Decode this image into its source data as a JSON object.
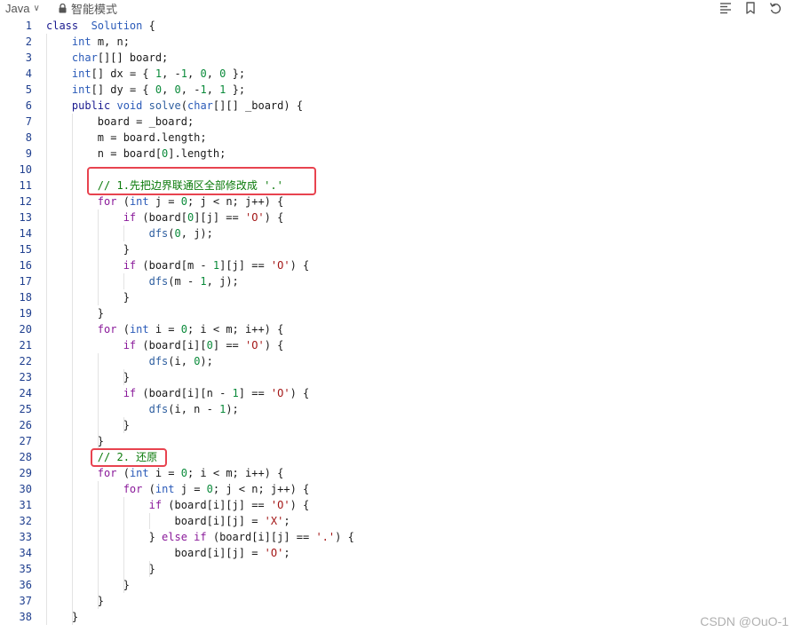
{
  "toolbar": {
    "language": "Java",
    "language_chevron": "∨",
    "mode_label": "智能模式"
  },
  "icons": [
    "chevron-down-icon",
    "lock-icon",
    "list-icon",
    "bookmark-icon",
    "undo-icon"
  ],
  "watermark": "CSDN @OuO-1",
  "colors": {
    "highlight": "#e8434f",
    "line_number": "#1f3f8f"
  },
  "lines": [
    {
      "n": "1",
      "toks": [
        [
          "kw",
          "class"
        ],
        [
          "",
          "  "
        ],
        [
          "ty",
          "Solution"
        ],
        [
          "",
          " {"
        ]
      ]
    },
    {
      "n": "2",
      "toks": [
        [
          "",
          "    "
        ],
        [
          "ty",
          "int"
        ],
        [
          "",
          " m, n;"
        ]
      ]
    },
    {
      "n": "3",
      "toks": [
        [
          "",
          "    "
        ],
        [
          "ty",
          "char"
        ],
        [
          "",
          "[][] board;"
        ]
      ]
    },
    {
      "n": "4",
      "toks": [
        [
          "",
          "    "
        ],
        [
          "ty",
          "int"
        ],
        [
          "",
          "[] dx = { "
        ],
        [
          "num",
          "1"
        ],
        [
          "",
          ", -"
        ],
        [
          "num",
          "1"
        ],
        [
          "",
          ", "
        ],
        [
          "num",
          "0"
        ],
        [
          "",
          ", "
        ],
        [
          "num",
          "0"
        ],
        [
          "",
          " };"
        ]
      ]
    },
    {
      "n": "5",
      "toks": [
        [
          "",
          "    "
        ],
        [
          "ty",
          "int"
        ],
        [
          "",
          "[] dy = { "
        ],
        [
          "num",
          "0"
        ],
        [
          "",
          ", "
        ],
        [
          "num",
          "0"
        ],
        [
          "",
          ", -"
        ],
        [
          "num",
          "1"
        ],
        [
          "",
          ", "
        ],
        [
          "num",
          "1"
        ],
        [
          "",
          " };"
        ]
      ]
    },
    {
      "n": "6",
      "toks": [
        [
          "",
          "    "
        ],
        [
          "kw",
          "public"
        ],
        [
          "",
          " "
        ],
        [
          "ty",
          "void"
        ],
        [
          "",
          " "
        ],
        [
          "fn",
          "solve"
        ],
        [
          "",
          "("
        ],
        [
          "ty",
          "char"
        ],
        [
          "",
          "[][] _board) {"
        ]
      ]
    },
    {
      "n": "7",
      "toks": [
        [
          "",
          "        board = _board;"
        ]
      ]
    },
    {
      "n": "8",
      "toks": [
        [
          "",
          "        m = board.length;"
        ]
      ]
    },
    {
      "n": "9",
      "toks": [
        [
          "",
          "        n = board["
        ],
        [
          "num",
          "0"
        ],
        [
          "",
          "].length;"
        ]
      ]
    },
    {
      "n": "10",
      "toks": []
    },
    {
      "n": "11",
      "toks": [
        [
          "",
          "        "
        ],
        [
          "cm",
          "// 1.先把边界联通区全部修改成 '.'"
        ]
      ]
    },
    {
      "n": "12",
      "toks": [
        [
          "",
          "        "
        ],
        [
          "ctl",
          "for"
        ],
        [
          "",
          " ("
        ],
        [
          "ty",
          "int"
        ],
        [
          "",
          " j = "
        ],
        [
          "num",
          "0"
        ],
        [
          "",
          "; j < n; j++) {"
        ]
      ]
    },
    {
      "n": "13",
      "toks": [
        [
          "",
          "            "
        ],
        [
          "ctl",
          "if"
        ],
        [
          "",
          " (board["
        ],
        [
          "num",
          "0"
        ],
        [
          "",
          "][j] == "
        ],
        [
          "str",
          "'O'"
        ],
        [
          "",
          ") {"
        ]
      ]
    },
    {
      "n": "14",
      "toks": [
        [
          "",
          "                "
        ],
        [
          "fn",
          "dfs"
        ],
        [
          "",
          "("
        ],
        [
          "num",
          "0"
        ],
        [
          "",
          ", j);"
        ]
      ]
    },
    {
      "n": "15",
      "toks": [
        [
          "",
          "            }"
        ]
      ]
    },
    {
      "n": "16",
      "toks": [
        [
          "",
          "            "
        ],
        [
          "ctl",
          "if"
        ],
        [
          "",
          " (board[m - "
        ],
        [
          "num",
          "1"
        ],
        [
          "",
          "][j] == "
        ],
        [
          "str",
          "'O'"
        ],
        [
          "",
          ") {"
        ]
      ]
    },
    {
      "n": "17",
      "toks": [
        [
          "",
          "                "
        ],
        [
          "fn",
          "dfs"
        ],
        [
          "",
          "(m - "
        ],
        [
          "num",
          "1"
        ],
        [
          "",
          ", j);"
        ]
      ]
    },
    {
      "n": "18",
      "toks": [
        [
          "",
          "            }"
        ]
      ]
    },
    {
      "n": "19",
      "toks": [
        [
          "",
          "        }"
        ]
      ]
    },
    {
      "n": "20",
      "toks": [
        [
          "",
          "        "
        ],
        [
          "ctl",
          "for"
        ],
        [
          "",
          " ("
        ],
        [
          "ty",
          "int"
        ],
        [
          "",
          " i = "
        ],
        [
          "num",
          "0"
        ],
        [
          "",
          "; i < m; i++) {"
        ]
      ]
    },
    {
      "n": "21",
      "toks": [
        [
          "",
          "            "
        ],
        [
          "ctl",
          "if"
        ],
        [
          "",
          " (board[i]["
        ],
        [
          "num",
          "0"
        ],
        [
          "",
          "] == "
        ],
        [
          "str",
          "'O'"
        ],
        [
          "",
          ") {"
        ]
      ]
    },
    {
      "n": "22",
      "toks": [
        [
          "",
          "                "
        ],
        [
          "fn",
          "dfs"
        ],
        [
          "",
          "(i, "
        ],
        [
          "num",
          "0"
        ],
        [
          "",
          ");"
        ]
      ]
    },
    {
      "n": "23",
      "toks": [
        [
          "",
          "            }"
        ]
      ]
    },
    {
      "n": "24",
      "toks": [
        [
          "",
          "            "
        ],
        [
          "ctl",
          "if"
        ],
        [
          "",
          " (board[i][n - "
        ],
        [
          "num",
          "1"
        ],
        [
          "",
          "] == "
        ],
        [
          "str",
          "'O'"
        ],
        [
          "",
          ") {"
        ]
      ]
    },
    {
      "n": "25",
      "toks": [
        [
          "",
          "                "
        ],
        [
          "fn",
          "dfs"
        ],
        [
          "",
          "(i, n - "
        ],
        [
          "num",
          "1"
        ],
        [
          "",
          ");"
        ]
      ]
    },
    {
      "n": "26",
      "toks": [
        [
          "",
          "            }"
        ]
      ]
    },
    {
      "n": "27",
      "toks": [
        [
          "",
          "        }"
        ]
      ]
    },
    {
      "n": "28",
      "toks": [
        [
          "",
          "        "
        ],
        [
          "cm",
          "// 2. 还原"
        ]
      ]
    },
    {
      "n": "29",
      "toks": [
        [
          "",
          "        "
        ],
        [
          "ctl",
          "for"
        ],
        [
          "",
          " ("
        ],
        [
          "ty",
          "int"
        ],
        [
          "",
          " i = "
        ],
        [
          "num",
          "0"
        ],
        [
          "",
          "; i < m; i++) {"
        ]
      ]
    },
    {
      "n": "30",
      "toks": [
        [
          "",
          "            "
        ],
        [
          "ctl",
          "for"
        ],
        [
          "",
          " ("
        ],
        [
          "ty",
          "int"
        ],
        [
          "",
          " j = "
        ],
        [
          "num",
          "0"
        ],
        [
          "",
          "; j < n; j++) {"
        ]
      ]
    },
    {
      "n": "31",
      "toks": [
        [
          "",
          "                "
        ],
        [
          "ctl",
          "if"
        ],
        [
          "",
          " (board[i][j] == "
        ],
        [
          "str",
          "'O'"
        ],
        [
          "",
          ") {"
        ]
      ]
    },
    {
      "n": "32",
      "toks": [
        [
          "",
          "                    board[i][j] = "
        ],
        [
          "str",
          "'X'"
        ],
        [
          "",
          ";"
        ]
      ]
    },
    {
      "n": "33",
      "toks": [
        [
          "",
          "                } "
        ],
        [
          "ctl",
          "else if"
        ],
        [
          "",
          " (board[i][j] == "
        ],
        [
          "str",
          "'.'"
        ],
        [
          "",
          ") {"
        ]
      ]
    },
    {
      "n": "34",
      "toks": [
        [
          "",
          "                    board[i][j] = "
        ],
        [
          "str",
          "'O'"
        ],
        [
          "",
          ";"
        ]
      ]
    },
    {
      "n": "35",
      "toks": [
        [
          "",
          "                }"
        ]
      ]
    },
    {
      "n": "36",
      "toks": [
        [
          "",
          "            }"
        ]
      ]
    },
    {
      "n": "37",
      "toks": [
        [
          "",
          "        }"
        ]
      ]
    },
    {
      "n": "38",
      "toks": [
        [
          "",
          "    }"
        ]
      ]
    }
  ]
}
